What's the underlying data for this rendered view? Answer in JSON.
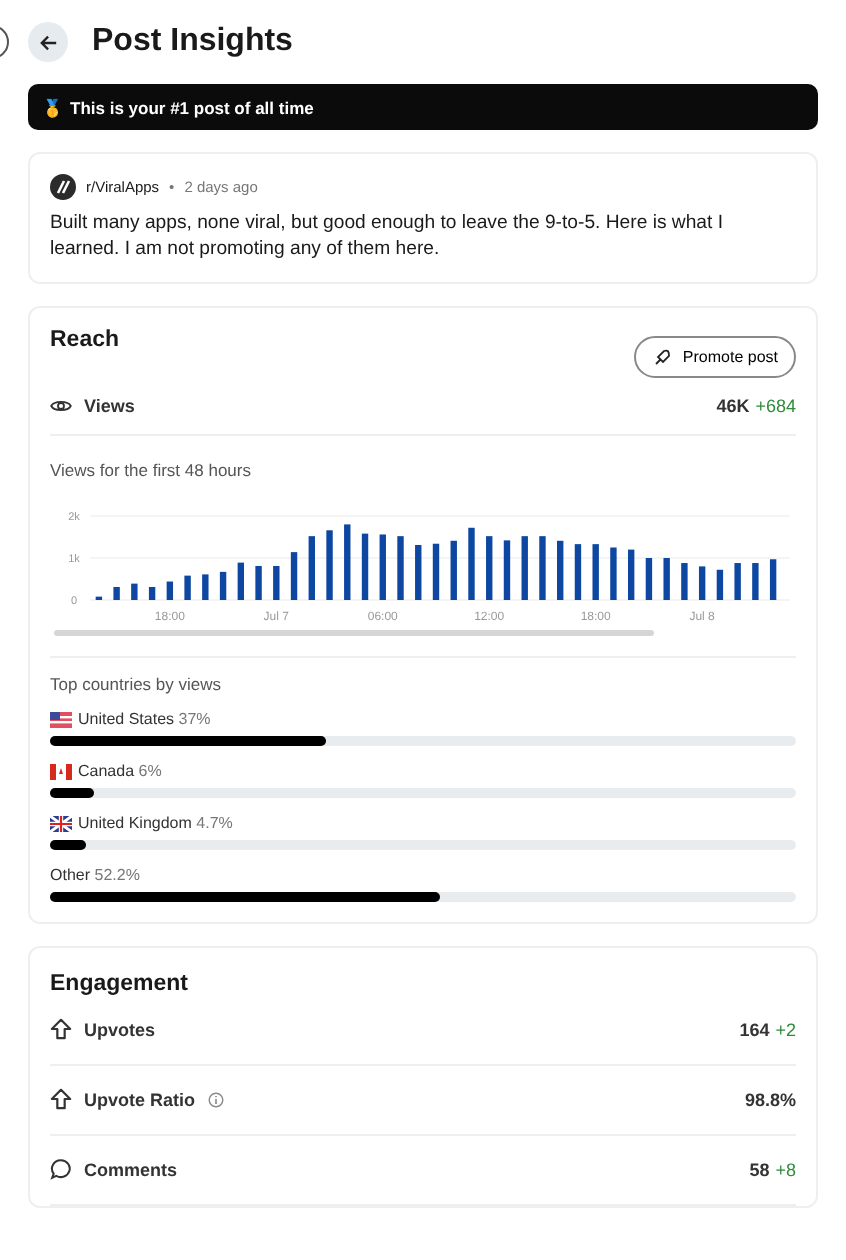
{
  "header": {
    "title": "Post Insights"
  },
  "banner": {
    "emoji": "🥇",
    "text": "This is your #1 post of all time"
  },
  "post": {
    "community": "r/ViralApps",
    "separator": "•",
    "age": "2 days ago",
    "title": "Built many apps, none viral, but good enough to leave the 9-to-5. Here is what I learned. I am not promoting any of them here."
  },
  "reach": {
    "title": "Reach",
    "promote_button": "Promote post",
    "views": {
      "label": "Views",
      "value": "46K",
      "delta": "+684"
    },
    "chart_title": "Views for the first 48 hours",
    "chart_data": {
      "type": "bar",
      "categories": [
        null,
        null,
        null,
        null,
        "18:00",
        null,
        null,
        null,
        null,
        null,
        "Jul 7",
        null,
        null,
        null,
        null,
        null,
        "06:00",
        null,
        null,
        null,
        null,
        null,
        "12:00",
        null,
        null,
        null,
        null,
        null,
        "18:00",
        null,
        null,
        null,
        null,
        null,
        "Jul 8",
        null,
        null,
        null,
        null
      ],
      "series": [
        {
          "color": "#0d47a1",
          "values": [
            80,
            310,
            390,
            310,
            440,
            580,
            610,
            670,
            890,
            810,
            810,
            1140,
            1520,
            1660,
            1800,
            1580,
            1560,
            1520,
            1310,
            1340,
            1410,
            1720,
            1520,
            1420,
            1520,
            1520,
            1410,
            1330,
            1330,
            1250,
            1200,
            1000,
            1000,
            880,
            800,
            720,
            880,
            880,
            970
          ]
        }
      ],
      "ylim": [
        0,
        2000
      ],
      "yticks": [
        {
          "value": 0,
          "label": "0"
        },
        {
          "value": 1000,
          "label": "1k"
        },
        {
          "value": 2000,
          "label": "2k"
        }
      ]
    },
    "countries_title": "Top countries by views",
    "countries": [
      {
        "kind": "us",
        "name": "United States",
        "share": "37%",
        "level": 0.37
      },
      {
        "kind": "ca",
        "name": "Canada",
        "share": "6%",
        "level": 0.06
      },
      {
        "kind": "uk",
        "name": "United Kingdom",
        "share": "4.7%",
        "level": 0.047
      },
      {
        "kind": "other",
        "name": "Other",
        "share": "52.2%",
        "level": 0.522
      }
    ]
  },
  "engagement": {
    "title": "Engagement",
    "rows": [
      {
        "kind": "upvote",
        "label": "Upvotes",
        "info": false,
        "value": "164",
        "delta": "+2"
      },
      {
        "kind": "upvote",
        "label": "Upvote Ratio",
        "info": true,
        "value": "98.8%"
      },
      {
        "kind": "comment",
        "label": "Comments",
        "info": false,
        "value": "58",
        "delta": "+8"
      }
    ]
  }
}
